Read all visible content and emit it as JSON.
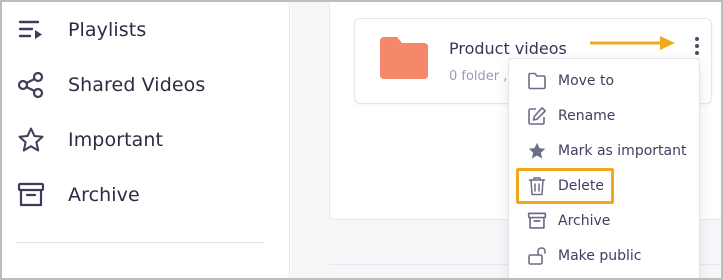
{
  "sidebar": {
    "items": [
      {
        "label": "Playlists",
        "icon": "playlist-icon"
      },
      {
        "label": "Shared Videos",
        "icon": "share-icon"
      },
      {
        "label": "Important",
        "icon": "star-icon"
      },
      {
        "label": "Archive",
        "icon": "archive-icon"
      }
    ]
  },
  "folder": {
    "title": "Product videos",
    "subtitle": "0 folder ,",
    "icon": "folder-icon",
    "color": "#f5886a"
  },
  "menu": {
    "items": [
      {
        "label": "Move to",
        "icon": "folder-outline-icon"
      },
      {
        "label": "Rename",
        "icon": "edit-icon"
      },
      {
        "label": "Mark as important",
        "icon": "star-filled-icon"
      },
      {
        "label": "Delete",
        "icon": "trash-icon"
      },
      {
        "label": "Archive",
        "icon": "archive-icon"
      },
      {
        "label": "Make public",
        "icon": "unlock-icon"
      }
    ]
  },
  "colors": {
    "annotation": "#f2a81d",
    "text": "#2a2b45",
    "icon": "#6b6e86"
  }
}
